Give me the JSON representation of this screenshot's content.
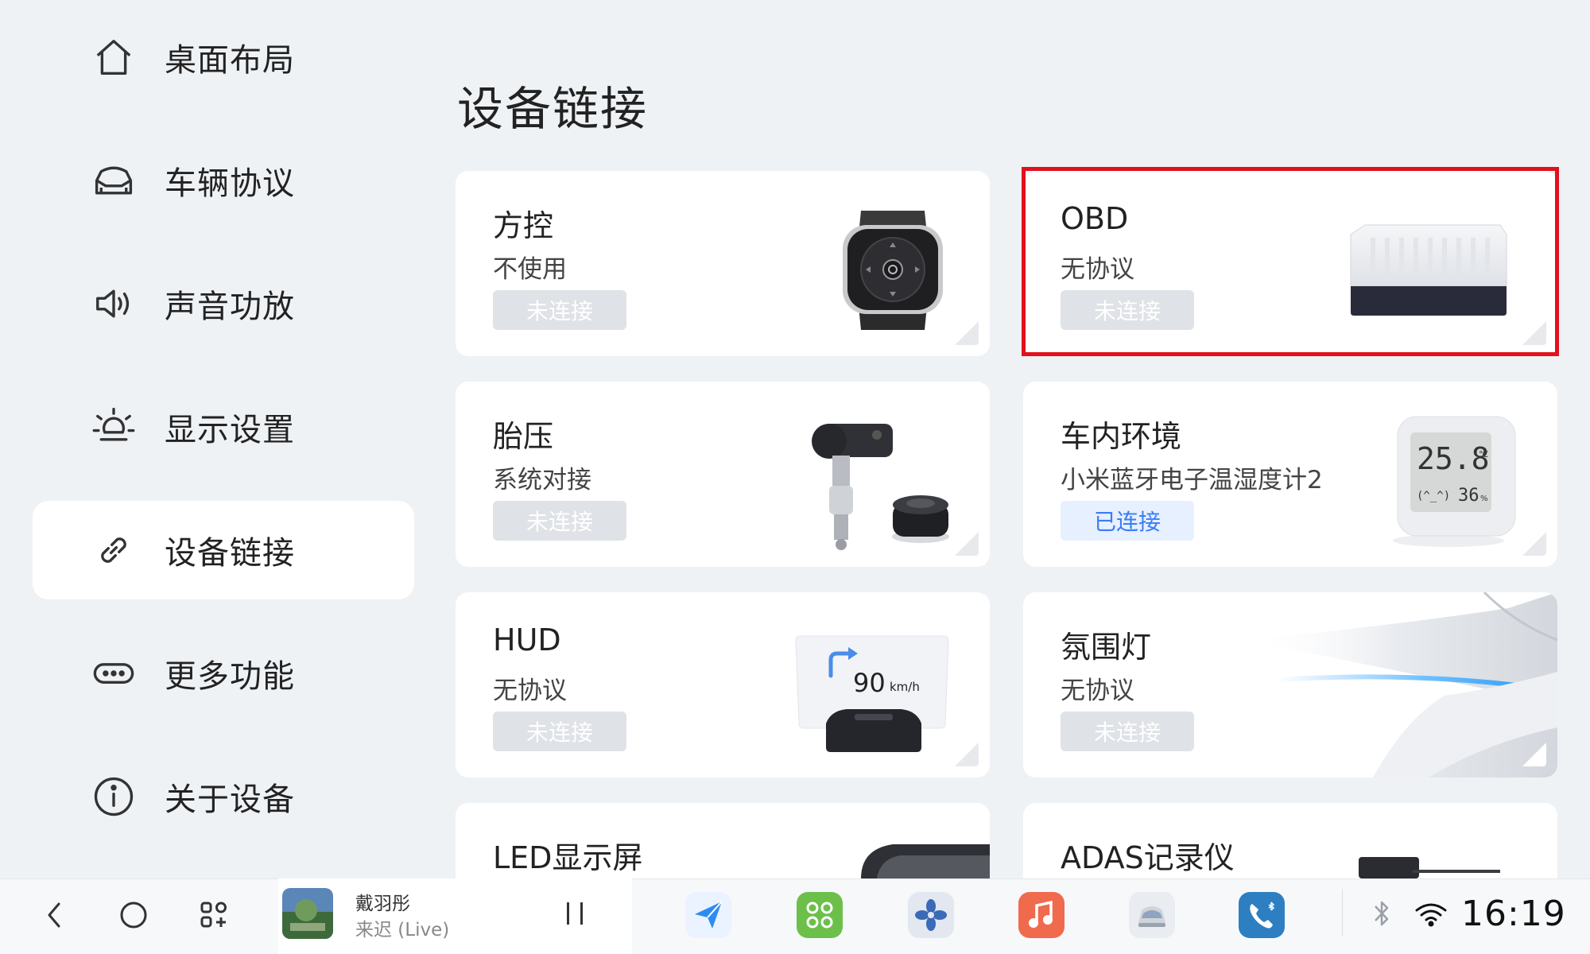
{
  "sidebar": {
    "items": [
      {
        "label": "桌面布局",
        "icon": "home-icon"
      },
      {
        "label": "车辆协议",
        "icon": "car-icon"
      },
      {
        "label": "声音功放",
        "icon": "speaker-icon"
      },
      {
        "label": "显示设置",
        "icon": "brightness-icon"
      },
      {
        "label": "设备链接",
        "icon": "link-icon",
        "active": true
      },
      {
        "label": "更多功能",
        "icon": "more-icon"
      },
      {
        "label": "关于设备",
        "icon": "info-icon"
      }
    ]
  },
  "main": {
    "title": "设备链接",
    "cards": [
      {
        "name": "方控",
        "sub": "不使用",
        "status": "未连接",
        "image": "steering-remote-image"
      },
      {
        "name": "OBD",
        "sub": "无协议",
        "status": "未连接",
        "image": "obd-device-image",
        "highlighted": true
      },
      {
        "name": "胎压",
        "sub": "系统对接",
        "status": "未连接",
        "image": "tire-sensor-image"
      },
      {
        "name": "车内环境",
        "sub": "小米蓝牙电子温湿度计2",
        "status": "已连接",
        "status_connected": true,
        "image": "thermometer-image",
        "display": {
          "temp": "25.8",
          "temp_unit": "℃",
          "face": "(^_^)",
          "humidity": "36",
          "humidity_unit": "%"
        }
      },
      {
        "name": "HUD",
        "sub": "无协议",
        "status": "未连接",
        "image": "hud-image",
        "display": {
          "speed": "90",
          "unit": "km/h"
        }
      },
      {
        "name": "氛围灯",
        "sub": "无协议",
        "status": "未连接",
        "image": "ambient-light-image"
      },
      {
        "name": "LED显示屏",
        "image": "led-screen-image"
      },
      {
        "name": "ADAS记录仪",
        "image": "adas-recorder-image"
      }
    ]
  },
  "bottombar": {
    "nav": [
      "back-icon",
      "home-circle-icon",
      "apps-grid-icon"
    ],
    "media": {
      "artist": "戴羽彤",
      "song": "来迟 (Live)"
    },
    "apps": [
      "navigation-app-icon",
      "apps-app-icon",
      "fan-app-icon",
      "music-app-icon",
      "car-app-icon",
      "phone-app-icon"
    ],
    "status": {
      "bluetooth": "bluetooth-icon",
      "wifi": "wifi-icon",
      "time": "16:19"
    }
  },
  "colors": {
    "background": "#eff2f5",
    "card": "#ffffff",
    "highlight": "#e3101e",
    "connected_text": "#3b7cf5",
    "connected_bg": "#e6f0ff",
    "disconnected_bg": "#dfe2e6"
  }
}
